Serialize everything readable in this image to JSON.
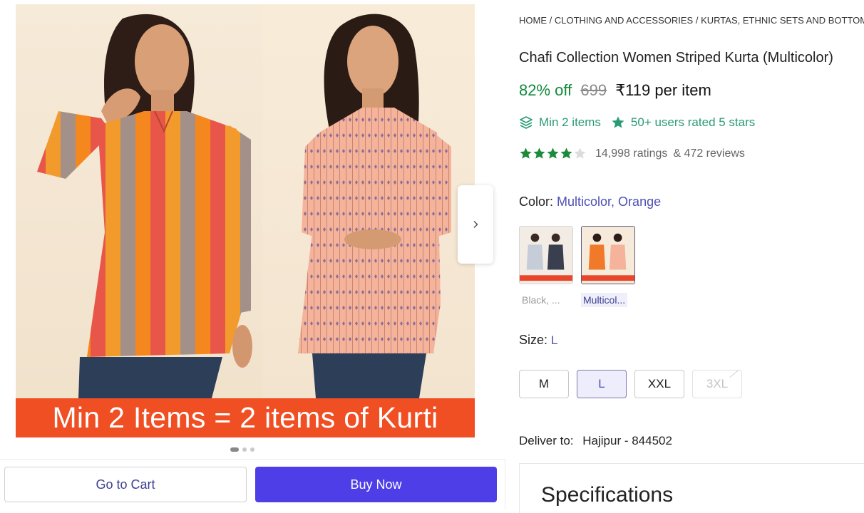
{
  "gallery": {
    "banner_text": "Min 2 Items = 2 items of Kurti",
    "dots": 3,
    "active_dot": 0,
    "next_icon": "chevron-right-icon"
  },
  "actions": {
    "cart_label": "Go to Cart",
    "buy_label": "Buy Now"
  },
  "breadcrumb": [
    "HOME",
    "CLOTHING AND ACCESSORIES",
    "KURTAS, ETHNIC SETS AND BOTTOMS"
  ],
  "breadcrumb_sep": "/",
  "product": {
    "title": "Chafi Collection Women Striped Kurta (Multicolor)",
    "discount": "82% off",
    "mrp": "699",
    "price": "₹119 per item",
    "min_items": "Min 2 items",
    "rated_text": "50+ users rated 5 stars",
    "rating_value": 4,
    "rating_max": 5,
    "ratings_count": "14,998 ratings",
    "reviews_count": "& 472 reviews"
  },
  "color": {
    "label": "Color:",
    "value": "Multicolor, Orange",
    "options": [
      {
        "label": "Black, ...",
        "selected": false
      },
      {
        "label": "Multicol...",
        "selected": true
      }
    ]
  },
  "size": {
    "label": "Size:",
    "value": "L",
    "options": [
      {
        "label": "M",
        "state": "available"
      },
      {
        "label": "L",
        "state": "selected"
      },
      {
        "label": "XXL",
        "state": "available"
      },
      {
        "label": "3XL",
        "state": "disabled"
      }
    ]
  },
  "delivery": {
    "label": "Deliver to:",
    "location": "Hajipur - 844502"
  },
  "specifications": {
    "title": "Specifications"
  },
  "colors": {
    "accent": "#4e3ee8",
    "discount_green": "#11893b",
    "offer_teal": "#2a9b77",
    "star_green": "#1b8a3a",
    "banner_orange": "#f04e23"
  }
}
